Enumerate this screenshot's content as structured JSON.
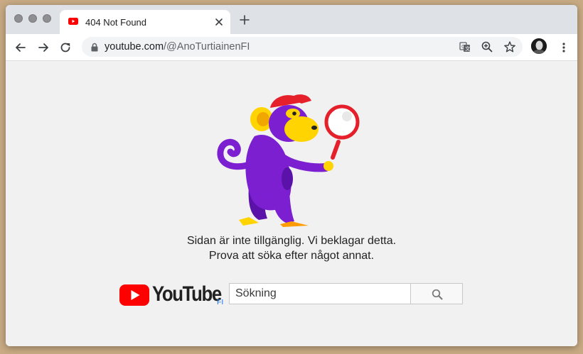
{
  "browser": {
    "tab": {
      "title": "404 Not Found",
      "favicon": "youtube-favicon-icon"
    },
    "new_tab_icon": "plus-icon",
    "address": {
      "domain": "youtube.com",
      "path": "/@AnoTurtiainenFI"
    },
    "icons": [
      "back-icon",
      "forward-icon",
      "reload-icon",
      "lock-icon",
      "translate-icon",
      "zoom-icon",
      "star-icon",
      "avatar",
      "menu-icon"
    ]
  },
  "page": {
    "message_line1": "Sidan är inte tillgänglig. Vi beklagar detta.",
    "message_line2": "Prova att söka efter något annat.",
    "logo": {
      "wordmark": "YouTube",
      "country": "FI"
    },
    "search": {
      "placeholder": "Sökning",
      "button_icon": "search-icon"
    },
    "illustration": "monkey-with-magnifier-icon"
  },
  "colors": {
    "youtube_red": "#ff0000",
    "monkey_purple": "#7b1fd1",
    "monkey_yellow": "#ffd400",
    "cap_red": "#e5202b"
  }
}
